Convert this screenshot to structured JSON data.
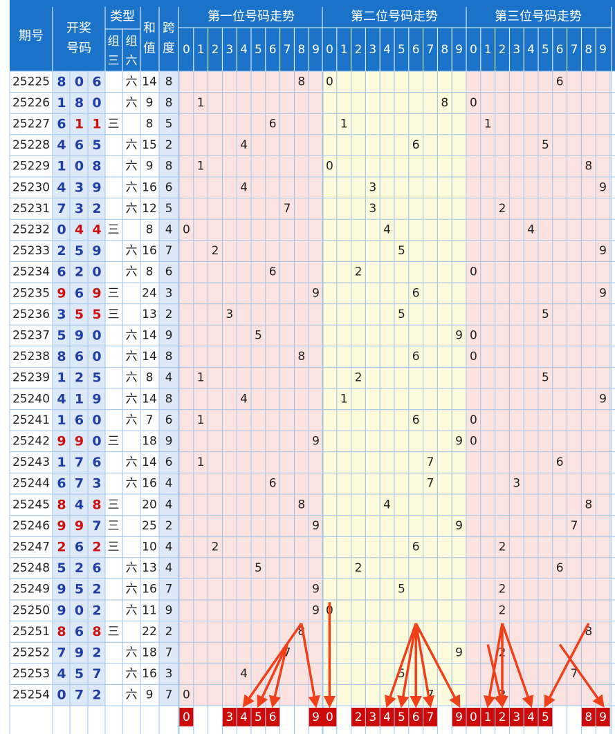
{
  "header": {
    "period_label": "期号",
    "draw_label_1": "开奖",
    "draw_label_2": "号码",
    "type_label": "类型",
    "type_sub_1a": "组",
    "type_sub_1b": "三",
    "type_sub_2a": "组",
    "type_sub_2b": "六",
    "sum_label_1": "和",
    "sum_label_2": "值",
    "span_label_1": "跨",
    "span_label_2": "度",
    "sections": [
      "第一位号码走势",
      "第二位号码走势",
      "第三位号码走势"
    ],
    "digits": [
      "0",
      "1",
      "2",
      "3",
      "4",
      "5",
      "6",
      "7",
      "8",
      "9"
    ]
  },
  "labels": {
    "zu3": "三",
    "zu6": "六"
  },
  "colors": {
    "header_bg": "#1a73c8",
    "header_text": "#ffffff",
    "period_bg": "#dde9f7",
    "number_blue": "#1f3fa6",
    "number_red": "#cc1111",
    "section1_bg": "#fde3e0",
    "section2_bg": "#fdfbdc",
    "section3_bg": "#fde3e0",
    "grid_line": "#9ec3ec",
    "pick_bg": "#cc0a0a",
    "arrow": "#f0401a"
  },
  "rows": [
    {
      "period": "25225",
      "nums": [
        8,
        0,
        6
      ],
      "type": "六",
      "sum": 14,
      "span": 8
    },
    {
      "period": "25226",
      "nums": [
        1,
        8,
        0
      ],
      "type": "六",
      "sum": 9,
      "span": 8
    },
    {
      "period": "25227",
      "nums": [
        6,
        1,
        1
      ],
      "type": "三",
      "sum": 8,
      "span": 5
    },
    {
      "period": "25228",
      "nums": [
        4,
        6,
        5
      ],
      "type": "六",
      "sum": 15,
      "span": 2
    },
    {
      "period": "25229",
      "nums": [
        1,
        0,
        8
      ],
      "type": "六",
      "sum": 9,
      "span": 8
    },
    {
      "period": "25230",
      "nums": [
        4,
        3,
        9
      ],
      "type": "六",
      "sum": 16,
      "span": 6
    },
    {
      "period": "25231",
      "nums": [
        7,
        3,
        2
      ],
      "type": "六",
      "sum": 12,
      "span": 5
    },
    {
      "period": "25232",
      "nums": [
        0,
        4,
        4
      ],
      "type": "三",
      "sum": 8,
      "span": 4
    },
    {
      "period": "25233",
      "nums": [
        2,
        5,
        9
      ],
      "type": "六",
      "sum": 16,
      "span": 7
    },
    {
      "period": "25234",
      "nums": [
        6,
        2,
        0
      ],
      "type": "六",
      "sum": 8,
      "span": 6
    },
    {
      "period": "25235",
      "nums": [
        9,
        6,
        9
      ],
      "type": "三",
      "sum": 24,
      "span": 3
    },
    {
      "period": "25236",
      "nums": [
        3,
        5,
        5
      ],
      "type": "三",
      "sum": 13,
      "span": 2
    },
    {
      "period": "25237",
      "nums": [
        5,
        9,
        0
      ],
      "type": "六",
      "sum": 14,
      "span": 9
    },
    {
      "period": "25238",
      "nums": [
        8,
        6,
        0
      ],
      "type": "六",
      "sum": 14,
      "span": 8
    },
    {
      "period": "25239",
      "nums": [
        1,
        2,
        5
      ],
      "type": "六",
      "sum": 8,
      "span": 4
    },
    {
      "period": "25240",
      "nums": [
        4,
        1,
        9
      ],
      "type": "六",
      "sum": 14,
      "span": 8
    },
    {
      "period": "25241",
      "nums": [
        1,
        6,
        0
      ],
      "type": "六",
      "sum": 7,
      "span": 6
    },
    {
      "period": "25242",
      "nums": [
        9,
        9,
        0
      ],
      "type": "三",
      "sum": 18,
      "span": 9
    },
    {
      "period": "25243",
      "nums": [
        1,
        7,
        6
      ],
      "type": "六",
      "sum": 14,
      "span": 6
    },
    {
      "period": "25244",
      "nums": [
        6,
        7,
        3
      ],
      "type": "六",
      "sum": 16,
      "span": 4
    },
    {
      "period": "25245",
      "nums": [
        8,
        4,
        8
      ],
      "type": "三",
      "sum": 20,
      "span": 4
    },
    {
      "period": "25246",
      "nums": [
        9,
        9,
        7
      ],
      "type": "三",
      "sum": 25,
      "span": 2
    },
    {
      "period": "25247",
      "nums": [
        2,
        6,
        2
      ],
      "type": "三",
      "sum": 10,
      "span": 4
    },
    {
      "period": "25248",
      "nums": [
        5,
        2,
        6
      ],
      "type": "六",
      "sum": 13,
      "span": 4
    },
    {
      "period": "25249",
      "nums": [
        9,
        5,
        2
      ],
      "type": "六",
      "sum": 16,
      "span": 7
    },
    {
      "period": "25250",
      "nums": [
        9,
        0,
        2
      ],
      "type": "六",
      "sum": 11,
      "span": 9
    },
    {
      "period": "25251",
      "nums": [
        8,
        6,
        8
      ],
      "type": "三",
      "sum": 22,
      "span": 2
    },
    {
      "period": "25252",
      "nums": [
        7,
        9,
        2
      ],
      "type": "六",
      "sum": 18,
      "span": 7
    },
    {
      "period": "25253",
      "nums": [
        4,
        5,
        7
      ],
      "type": "六",
      "sum": 16,
      "span": 3
    },
    {
      "period": "25254",
      "nums": [
        0,
        7,
        2
      ],
      "type": "六",
      "sum": 9,
      "span": 7
    }
  ],
  "chart_data": {
    "type": "table",
    "columns": [
      "期号",
      "开奖号码",
      "类型",
      "和值",
      "跨度",
      "第一位号码走势",
      "第二位号码走势",
      "第三位号码走势"
    ],
    "picks": {
      "position1": [
        0,
        3,
        4,
        5,
        6,
        9
      ],
      "position2": [
        0,
        2,
        3,
        4,
        5,
        6,
        7,
        9
      ],
      "position3": [
        0,
        1,
        2,
        3,
        4,
        5,
        8,
        9
      ]
    },
    "arrows": [
      {
        "from": [
          0,
          8,
          25251
        ],
        "to_pick": [
          0,
          4
        ]
      },
      {
        "from": [
          0,
          7,
          25252
        ],
        "to_pick": [
          0,
          5
        ]
      },
      {
        "from": [
          0,
          7,
          25252
        ],
        "to_pick": [
          0,
          6
        ]
      },
      {
        "from": [
          0,
          8,
          25251
        ],
        "to_pick": [
          0,
          9
        ]
      },
      {
        "from": [
          1,
          0,
          25250
        ],
        "to_pick": [
          1,
          0
        ]
      },
      {
        "from": [
          1,
          6,
          25251
        ],
        "to_pick": [
          1,
          4
        ]
      },
      {
        "from": [
          1,
          6,
          25251
        ],
        "to_pick": [
          1,
          5
        ]
      },
      {
        "from": [
          1,
          6,
          25251
        ],
        "to_pick": [
          1,
          6
        ]
      },
      {
        "from": [
          1,
          6,
          25251
        ],
        "to_pick": [
          1,
          7
        ]
      },
      {
        "from": [
          1,
          6,
          25251
        ],
        "to_pick": [
          1,
          9
        ]
      },
      {
        "from": [
          2,
          2,
          25251
        ],
        "to_pick": [
          2,
          1
        ]
      },
      {
        "from": [
          2,
          2,
          25251
        ],
        "to_pick": [
          2,
          2
        ]
      },
      {
        "from": [
          2,
          2,
          25251
        ],
        "to_pick": [
          2,
          4
        ]
      },
      {
        "from": [
          2,
          1,
          25252
        ],
        "to_pick": [
          2,
          2
        ]
      },
      {
        "from": [
          2,
          8,
          25251
        ],
        "to_pick": [
          2,
          5
        ]
      },
      {
        "from": [
          2,
          6,
          25252
        ],
        "to_pick": [
          2,
          9
        ]
      }
    ]
  }
}
